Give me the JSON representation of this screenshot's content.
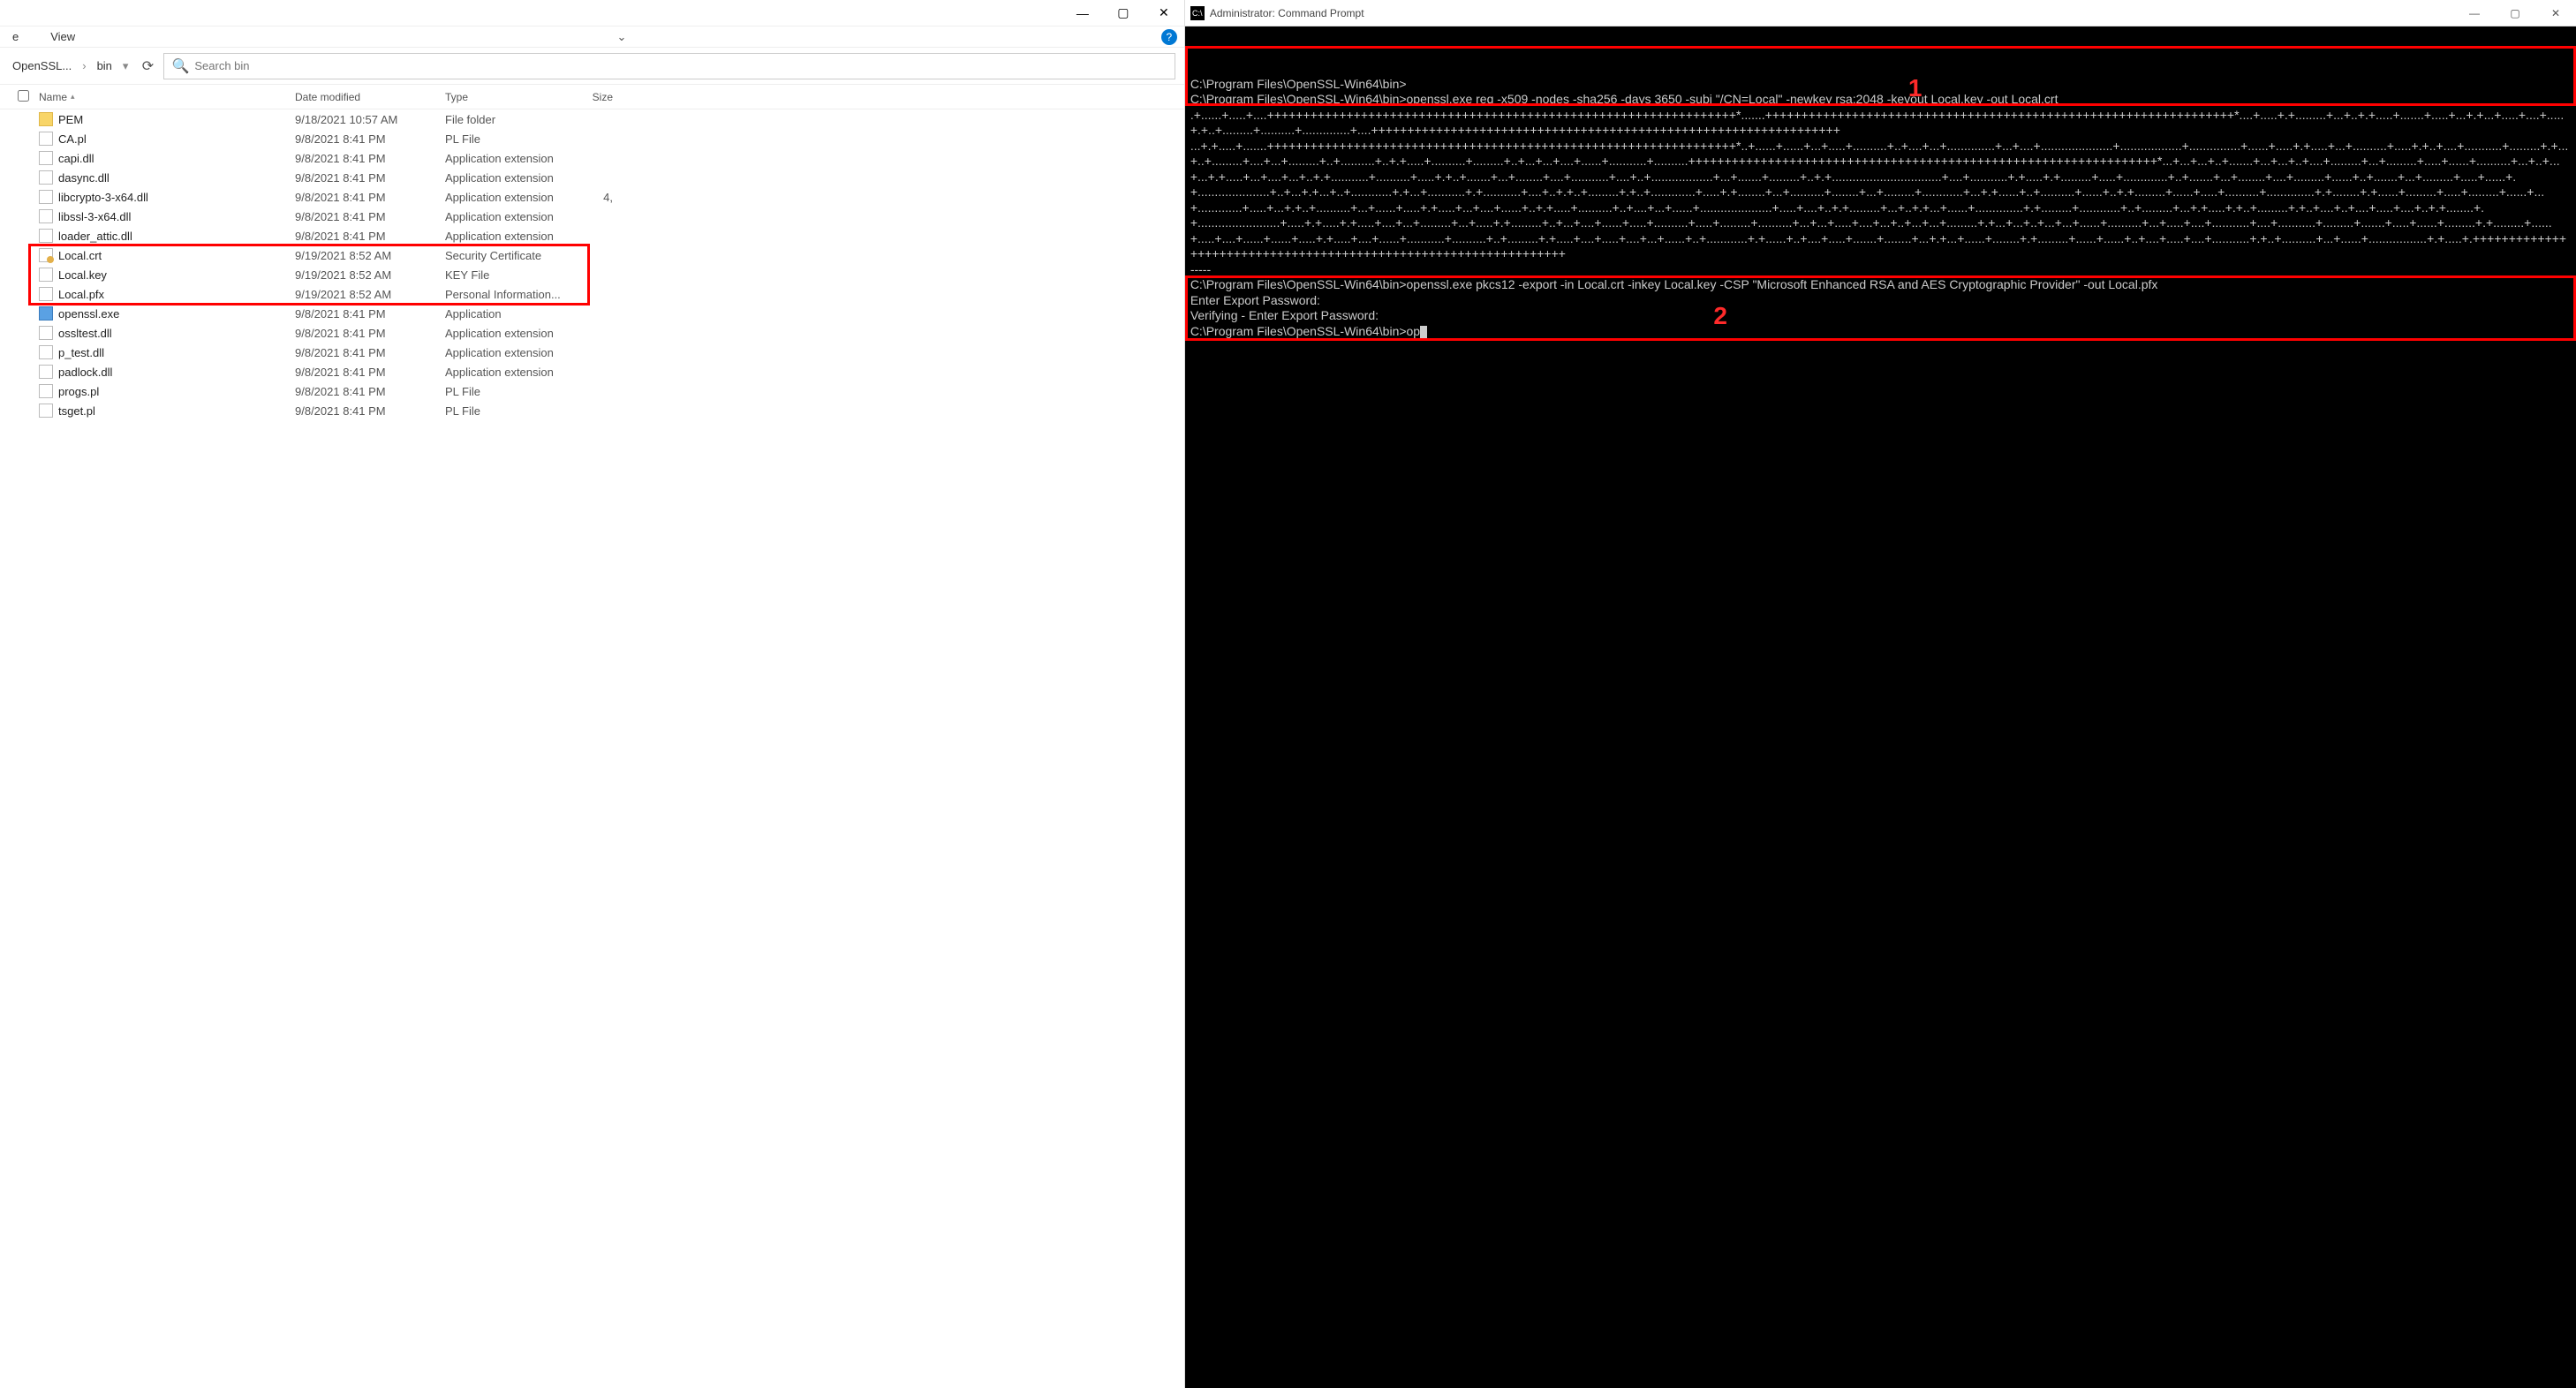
{
  "explorer": {
    "tab_view": "View",
    "tab_other": "e",
    "crumbs": [
      "OpenSSL...",
      "bin"
    ],
    "crumb_drop": "▾",
    "search_placeholder": "Search bin",
    "columns": {
      "name": "Name",
      "date": "Date modified",
      "type": "Type",
      "size": "Size"
    },
    "rows": [
      {
        "icon": "folder",
        "name": "PEM",
        "date": "9/18/2021 10:57 AM",
        "type": "File folder",
        "size": ""
      },
      {
        "icon": "file",
        "name": "CA.pl",
        "date": "9/8/2021 8:41 PM",
        "type": "PL File",
        "size": ""
      },
      {
        "icon": "file",
        "name": "capi.dll",
        "date": "9/8/2021 8:41 PM",
        "type": "Application extension",
        "size": ""
      },
      {
        "icon": "file",
        "name": "dasync.dll",
        "date": "9/8/2021 8:41 PM",
        "type": "Application extension",
        "size": ""
      },
      {
        "icon": "file",
        "name": "libcrypto-3-x64.dll",
        "date": "9/8/2021 8:41 PM",
        "type": "Application extension",
        "size": "4,"
      },
      {
        "icon": "file",
        "name": "libssl-3-x64.dll",
        "date": "9/8/2021 8:41 PM",
        "type": "Application extension",
        "size": ""
      },
      {
        "icon": "file",
        "name": "loader_attic.dll",
        "date": "9/8/2021 8:41 PM",
        "type": "Application extension",
        "size": ""
      },
      {
        "icon": "cert",
        "name": "Local.crt",
        "date": "9/19/2021 8:52 AM",
        "type": "Security Certificate",
        "size": ""
      },
      {
        "icon": "file",
        "name": "Local.key",
        "date": "9/19/2021 8:52 AM",
        "type": "KEY File",
        "size": ""
      },
      {
        "icon": "file",
        "name": "Local.pfx",
        "date": "9/19/2021 8:52 AM",
        "type": "Personal Information...",
        "size": ""
      },
      {
        "icon": "exe",
        "name": "openssl.exe",
        "date": "9/8/2021 8:41 PM",
        "type": "Application",
        "size": ""
      },
      {
        "icon": "file",
        "name": "ossltest.dll",
        "date": "9/8/2021 8:41 PM",
        "type": "Application extension",
        "size": ""
      },
      {
        "icon": "file",
        "name": "p_test.dll",
        "date": "9/8/2021 8:41 PM",
        "type": "Application extension",
        "size": ""
      },
      {
        "icon": "file",
        "name": "padlock.dll",
        "date": "9/8/2021 8:41 PM",
        "type": "Application extension",
        "size": ""
      },
      {
        "icon": "file",
        "name": "progs.pl",
        "date": "9/8/2021 8:41 PM",
        "type": "PL File",
        "size": ""
      },
      {
        "icon": "file",
        "name": "tsget.pl",
        "date": "9/8/2021 8:41 PM",
        "type": "PL File",
        "size": ""
      }
    ]
  },
  "cmd": {
    "title": "Administrator: Command Prompt",
    "prompt_path": "C:\\Program Files\\OpenSSL-Win64\\bin>",
    "cmd1": "openssl.exe req -x509 -nodes -sha256 -days 3650 -subj \"/CN=Local\" -newkey rsa:2048 -keyout Local.key -out Local.crt",
    "cmd2": "openssl.exe pkcs12 -export -in Local.crt -inkey Local.key -CSP \"Microsoft Enhanced RSA and AES Cryptographic Provider\" -out Local.pfx",
    "pwd1": "Enter Export Password:",
    "pwd2": "Verifying - Enter Export Password:",
    "last": "op",
    "anno1": "1",
    "anno2": "2",
    "prog1": ".+......+.....+....+++++++++++++++++++++++++++++++++++++++++++++++++++++++++++++++++*.......+++++++++++++++++++++++++++++++++++++++++++++++++++++++++++++++++*....+.....+.+.........+...+..+.+.....+.......+.....+...+.+...+.....+....+.....+.+..+.........+..........+..............+....+++++++++++++++++++++++++++++++++++++++++++++++++++++++++++++++++",
    "prog2": "...+.+.....+.......+++++++++++++++++++++++++++++++++++++++++++++++++++++++++++++++++*..+......+......+...+.....+..........+..+....+...+..............+...+....+.....................+..................+...............+......+.....+.+.....+...+..........+.....+.+..+....+...........+.........+.+...+..+.........+....+...+.........+..+..........+..+.+.....+..........+.........+..+...+...+....+......+...........+..........+++++++++++++++++++++++++++++++++++++++++++++++++++++++++++++++++*...+...+...+..+.......+...+...+..+....+.........+...+.........+.....+......+..........+...+..+...+...+.+.....+...+....+...+..+.+...........+..........+.....+.+..+.......+...+........+....+...........+....+..+..................+...+.......+.........+..+.+................................+....+...........+.+.....+.+.........+.....+.............+..+.......+...+........+....+.........+......+..+.......+...+.........+.....+......+.+.....................+..+...+.+...+..+............+.+...+...........+.+...........+....+..+.+..+.........+.+..+.............+.....+.+........+...+..........+........+...+.........+............+...+.+......+..+..........+......+..+.+.........+......+.....+..........+..............+.+........+.+......+.........+.....+.........+......+...+.............+.....+...+.+..+..........+...+......+.....+.+.....+...+....+......+..+.+.....+..........+..+....+...+......+.....................+.....+....+..+.+.........+...+..+.+...+......+..............+.+.........+............+..+.........+...+.+.....+.+..+.........+.+..+....+..+....+.....+....+..+.+........+.+........................+.....+.+.....+.+.....+....+...+.........+...+.....+.+.........+..+...+....+......+.....+..........+.....+.........+..........+...+...+.....+....+...+..+...+...+.........+.+...+...+..+...+...+......+..........+...+.....+....+...........+....+...........+.........+.......+.....+......+.........+.+.........+......+.....+....+......+......+.....+.+.....+....+......+...........+..........+..+.........+.+.....+....+.....+....+...+......+..+............+.+......+..+....+.....+.......+........+...+.+...+......+........+.+.........+......+......+..+....+.....+....+...........+.+..+..........+...+......+.................+.+.....+.+++++++++++++++++++++++++++++++++++++++++++++++++++++++++++++++++",
    "dashes": "-----"
  }
}
